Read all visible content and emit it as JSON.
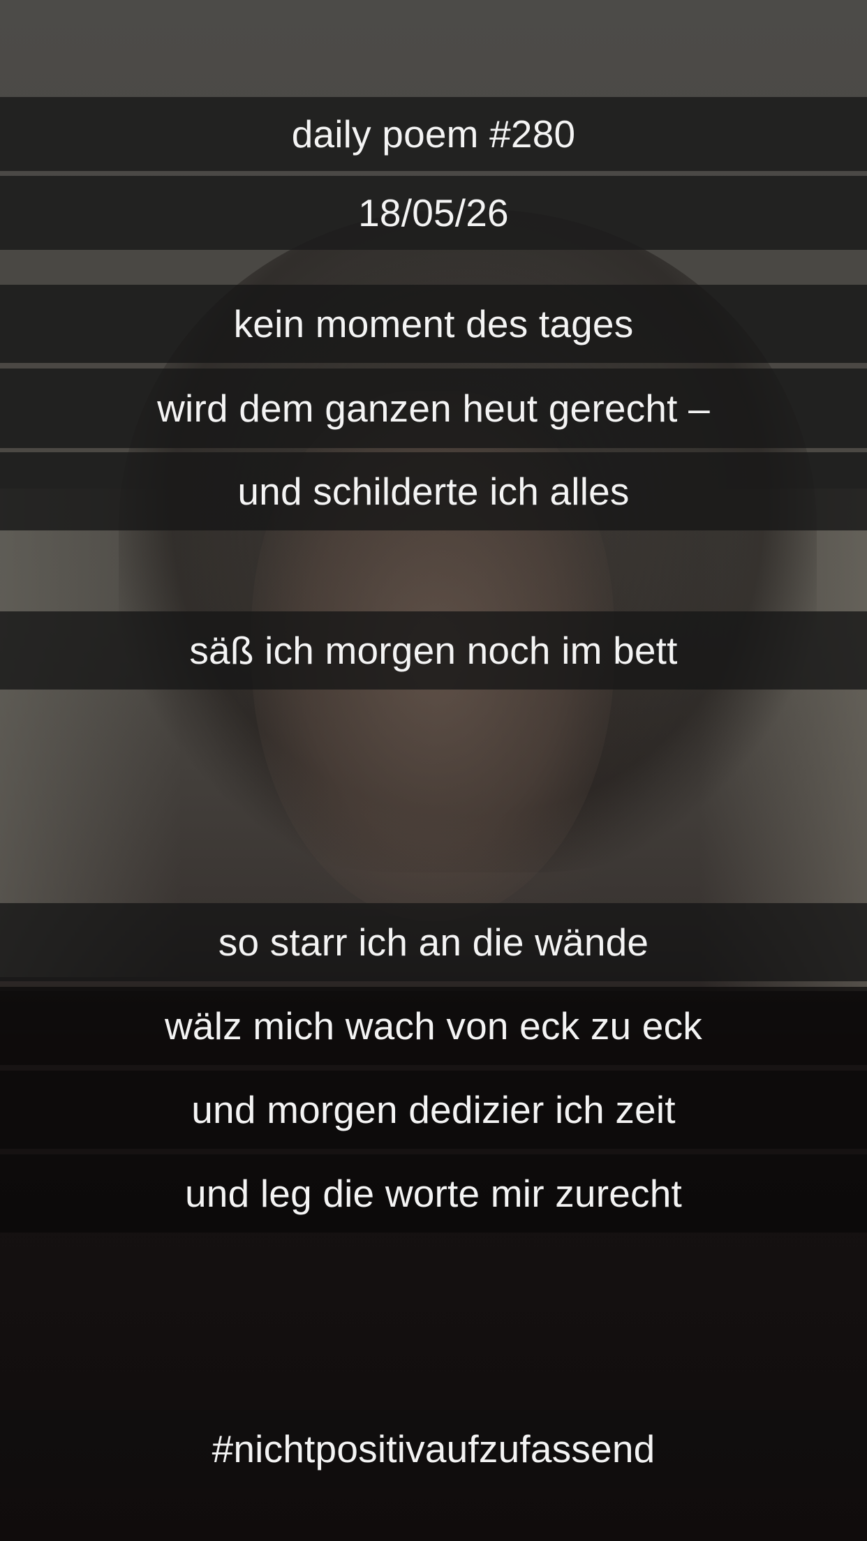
{
  "header": {
    "title": "daily poem #280",
    "date": "18/05/26"
  },
  "stanza1": {
    "line1": "kein moment des tages",
    "line2": "wird dem ganzen heut gerecht –",
    "line3": "und schilderte ich alles",
    "line4": "säß ich morgen noch im bett"
  },
  "stanza2": {
    "line1": "so starr ich an die wände",
    "line2": "wälz mich wach von eck zu eck",
    "line3": "und morgen dedizier ich zeit",
    "line4": "und leg die worte mir zurecht"
  },
  "footer": {
    "hashtag": "#nichtpositivaufzufassend"
  }
}
